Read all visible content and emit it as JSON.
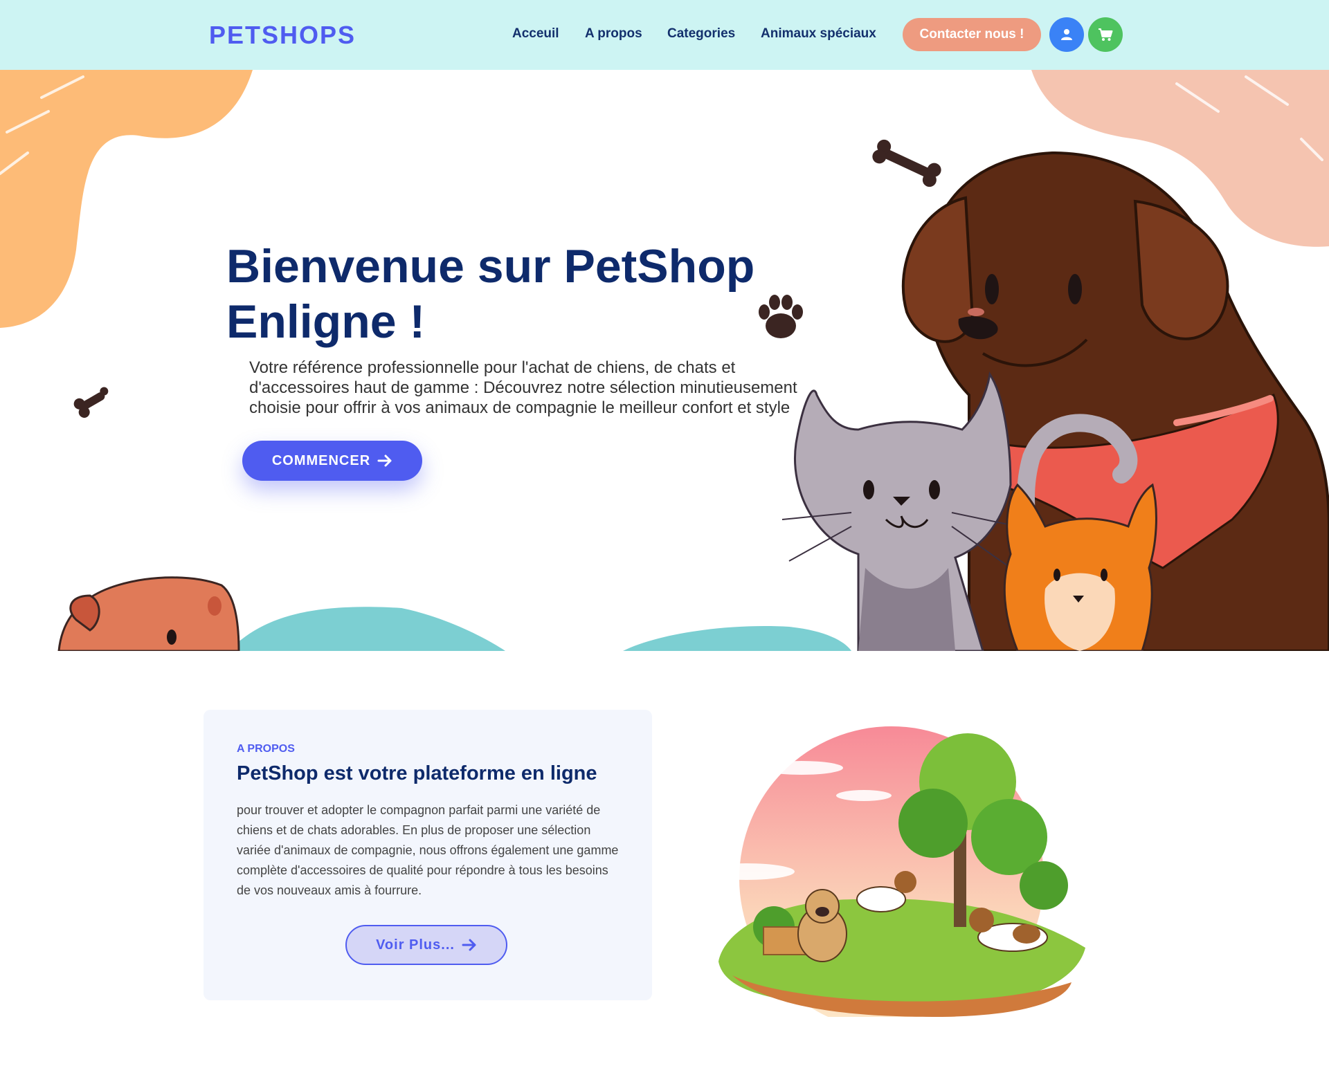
{
  "navbar": {
    "brand": "PETSHOPS",
    "links": [
      {
        "label": "Acceuil"
      },
      {
        "label": "A propos"
      },
      {
        "label": "Categories"
      },
      {
        "label": "Animaux spéciaux"
      }
    ],
    "contact_label": "Contacter nous !",
    "user_icon": "user-icon",
    "cart_icon": "cart-icon"
  },
  "hero": {
    "title": "Bienvenue sur PetShop Enligne !",
    "description": "Votre référence professionnelle pour l'achat de chiens, de chats et d'accessoires haut de gamme : Découvrez notre sélection minutieusement choisie pour offrir à vos animaux de compagnie le meilleur confort et style",
    "cta_label": "COMMENCER",
    "cta_icon": "arrow-right-icon"
  },
  "about": {
    "kicker": "A PROPOS",
    "title": "PetShop est votre plateforme en ligne",
    "text": "pour trouver et adopter le compagnon parfait parmi une variété de chiens et de chats adorables. En plus de proposer une sélection variée d'animaux de compagnie, nous offrons également une gamme complète d'accessoires de qualité pour répondre à tous les besoins de vos nouveaux amis à fourrure.",
    "button_label": "Voir Plus...",
    "button_icon": "arrow-right-icon"
  },
  "colors": {
    "navbar_bg": "#cdf4f3",
    "accent": "#4f5cf0",
    "heading": "#0e2a6b",
    "contact_button": "#ee9b80",
    "user_button": "#3a82f6",
    "cart_button": "#4ec35f",
    "about_card_bg": "#f3f6fd"
  }
}
